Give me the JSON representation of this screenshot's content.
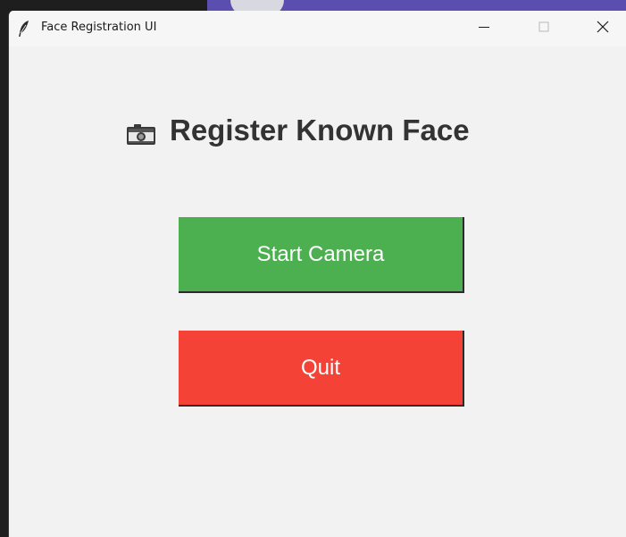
{
  "window": {
    "title": "Face Registration UI",
    "icon": "feather-icon",
    "controls": [
      "minimize-icon",
      "maximize-icon",
      "close-icon"
    ]
  },
  "main": {
    "heading_icon": "camera-icon",
    "heading": "Register Known Face",
    "start_button": "Start Camera",
    "quit_button": "Quit"
  },
  "colors": {
    "start_button_bg": "#4caf50",
    "quit_button_bg": "#f44336",
    "heading_text": "#333333",
    "window_bg": "#f2f2f2"
  }
}
